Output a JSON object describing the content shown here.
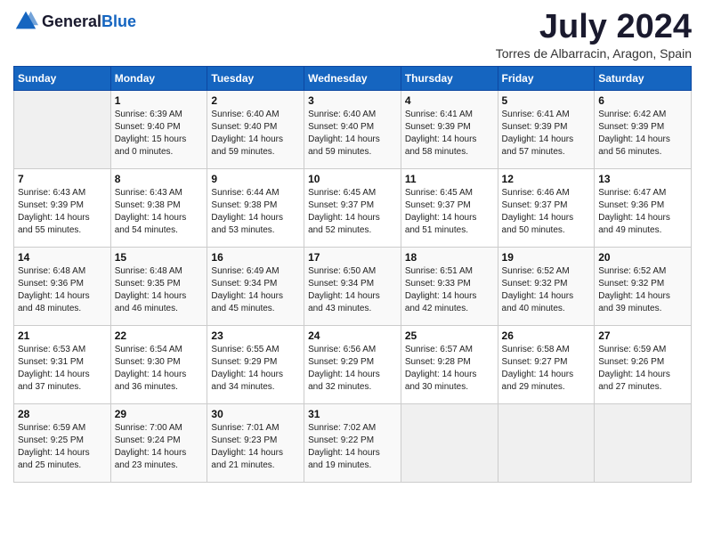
{
  "logo": {
    "general": "General",
    "blue": "Blue"
  },
  "title": {
    "month": "July 2024",
    "location": "Torres de Albarracin, Aragon, Spain"
  },
  "headers": [
    "Sunday",
    "Monday",
    "Tuesday",
    "Wednesday",
    "Thursday",
    "Friday",
    "Saturday"
  ],
  "weeks": [
    [
      {
        "day": "",
        "info": ""
      },
      {
        "day": "1",
        "info": "Sunrise: 6:39 AM\nSunset: 9:40 PM\nDaylight: 15 hours\nand 0 minutes."
      },
      {
        "day": "2",
        "info": "Sunrise: 6:40 AM\nSunset: 9:40 PM\nDaylight: 14 hours\nand 59 minutes."
      },
      {
        "day": "3",
        "info": "Sunrise: 6:40 AM\nSunset: 9:40 PM\nDaylight: 14 hours\nand 59 minutes."
      },
      {
        "day": "4",
        "info": "Sunrise: 6:41 AM\nSunset: 9:39 PM\nDaylight: 14 hours\nand 58 minutes."
      },
      {
        "day": "5",
        "info": "Sunrise: 6:41 AM\nSunset: 9:39 PM\nDaylight: 14 hours\nand 57 minutes."
      },
      {
        "day": "6",
        "info": "Sunrise: 6:42 AM\nSunset: 9:39 PM\nDaylight: 14 hours\nand 56 minutes."
      }
    ],
    [
      {
        "day": "7",
        "info": "Sunrise: 6:43 AM\nSunset: 9:39 PM\nDaylight: 14 hours\nand 55 minutes."
      },
      {
        "day": "8",
        "info": "Sunrise: 6:43 AM\nSunset: 9:38 PM\nDaylight: 14 hours\nand 54 minutes."
      },
      {
        "day": "9",
        "info": "Sunrise: 6:44 AM\nSunset: 9:38 PM\nDaylight: 14 hours\nand 53 minutes."
      },
      {
        "day": "10",
        "info": "Sunrise: 6:45 AM\nSunset: 9:37 PM\nDaylight: 14 hours\nand 52 minutes."
      },
      {
        "day": "11",
        "info": "Sunrise: 6:45 AM\nSunset: 9:37 PM\nDaylight: 14 hours\nand 51 minutes."
      },
      {
        "day": "12",
        "info": "Sunrise: 6:46 AM\nSunset: 9:37 PM\nDaylight: 14 hours\nand 50 minutes."
      },
      {
        "day": "13",
        "info": "Sunrise: 6:47 AM\nSunset: 9:36 PM\nDaylight: 14 hours\nand 49 minutes."
      }
    ],
    [
      {
        "day": "14",
        "info": "Sunrise: 6:48 AM\nSunset: 9:36 PM\nDaylight: 14 hours\nand 48 minutes."
      },
      {
        "day": "15",
        "info": "Sunrise: 6:48 AM\nSunset: 9:35 PM\nDaylight: 14 hours\nand 46 minutes."
      },
      {
        "day": "16",
        "info": "Sunrise: 6:49 AM\nSunset: 9:34 PM\nDaylight: 14 hours\nand 45 minutes."
      },
      {
        "day": "17",
        "info": "Sunrise: 6:50 AM\nSunset: 9:34 PM\nDaylight: 14 hours\nand 43 minutes."
      },
      {
        "day": "18",
        "info": "Sunrise: 6:51 AM\nSunset: 9:33 PM\nDaylight: 14 hours\nand 42 minutes."
      },
      {
        "day": "19",
        "info": "Sunrise: 6:52 AM\nSunset: 9:32 PM\nDaylight: 14 hours\nand 40 minutes."
      },
      {
        "day": "20",
        "info": "Sunrise: 6:52 AM\nSunset: 9:32 PM\nDaylight: 14 hours\nand 39 minutes."
      }
    ],
    [
      {
        "day": "21",
        "info": "Sunrise: 6:53 AM\nSunset: 9:31 PM\nDaylight: 14 hours\nand 37 minutes."
      },
      {
        "day": "22",
        "info": "Sunrise: 6:54 AM\nSunset: 9:30 PM\nDaylight: 14 hours\nand 36 minutes."
      },
      {
        "day": "23",
        "info": "Sunrise: 6:55 AM\nSunset: 9:29 PM\nDaylight: 14 hours\nand 34 minutes."
      },
      {
        "day": "24",
        "info": "Sunrise: 6:56 AM\nSunset: 9:29 PM\nDaylight: 14 hours\nand 32 minutes."
      },
      {
        "day": "25",
        "info": "Sunrise: 6:57 AM\nSunset: 9:28 PM\nDaylight: 14 hours\nand 30 minutes."
      },
      {
        "day": "26",
        "info": "Sunrise: 6:58 AM\nSunset: 9:27 PM\nDaylight: 14 hours\nand 29 minutes."
      },
      {
        "day": "27",
        "info": "Sunrise: 6:59 AM\nSunset: 9:26 PM\nDaylight: 14 hours\nand 27 minutes."
      }
    ],
    [
      {
        "day": "28",
        "info": "Sunrise: 6:59 AM\nSunset: 9:25 PM\nDaylight: 14 hours\nand 25 minutes."
      },
      {
        "day": "29",
        "info": "Sunrise: 7:00 AM\nSunset: 9:24 PM\nDaylight: 14 hours\nand 23 minutes."
      },
      {
        "day": "30",
        "info": "Sunrise: 7:01 AM\nSunset: 9:23 PM\nDaylight: 14 hours\nand 21 minutes."
      },
      {
        "day": "31",
        "info": "Sunrise: 7:02 AM\nSunset: 9:22 PM\nDaylight: 14 hours\nand 19 minutes."
      },
      {
        "day": "",
        "info": ""
      },
      {
        "day": "",
        "info": ""
      },
      {
        "day": "",
        "info": ""
      }
    ]
  ]
}
